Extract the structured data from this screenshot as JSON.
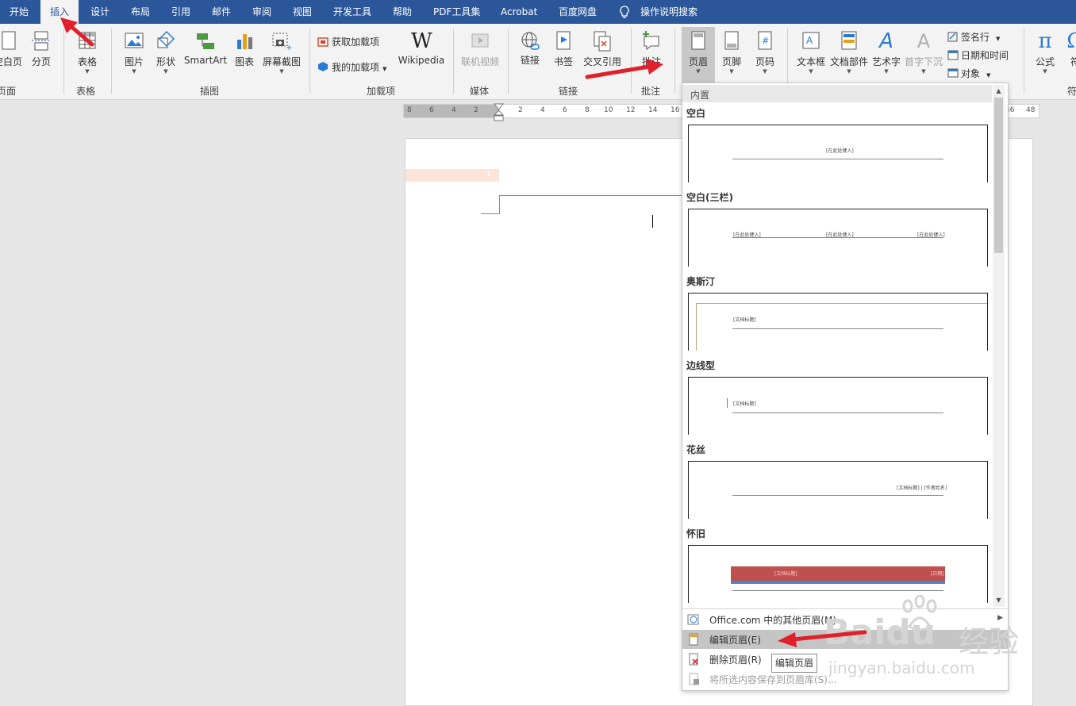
{
  "tabs": [
    {
      "label": "开始"
    },
    {
      "label": "插入"
    },
    {
      "label": "设计"
    },
    {
      "label": "布局"
    },
    {
      "label": "引用"
    },
    {
      "label": "邮件"
    },
    {
      "label": "审阅"
    },
    {
      "label": "视图"
    },
    {
      "label": "开发工具"
    },
    {
      "label": "帮助"
    },
    {
      "label": "PDF工具集"
    },
    {
      "label": "Acrobat"
    },
    {
      "label": "百度网盘"
    }
  ],
  "tell_me": "操作说明搜索",
  "ribbon": {
    "pages": {
      "blank_page": "空白页",
      "page_break": "分页",
      "label": "页面"
    },
    "tables": {
      "table": "表格",
      "label": "表格"
    },
    "illustrations": {
      "picture": "图片",
      "shapes": "形状",
      "smartart": "SmartArt",
      "chart": "图表",
      "screenshot": "屏幕截图",
      "label": "插图"
    },
    "addins": {
      "get": "获取加载项",
      "my": "我的加载项",
      "wikipedia": "Wikipedia",
      "label": "加载项"
    },
    "media": {
      "online_video": "联机视频",
      "label": "媒体"
    },
    "links": {
      "link": "链接",
      "bookmark": "书签",
      "cross_ref": "交叉引用",
      "label": "链接"
    },
    "comments": {
      "comment": "批注",
      "label": "批注"
    },
    "header_footer": {
      "header": "页眉",
      "footer": "页脚",
      "page_number": "页码"
    },
    "text": {
      "textbox": "文本框",
      "quick_parts": "文档部件",
      "wordart": "艺术字",
      "dropcap": "首字下沉",
      "signature": "签名行",
      "datetime": "日期和时间",
      "object": "对象"
    },
    "symbols": {
      "equation": "公式",
      "symbol": "符",
      "label": "符"
    }
  },
  "ruler": [
    "8",
    "6",
    "4",
    "2",
    "2",
    "4",
    "6",
    "8",
    "10",
    "12",
    "14",
    "16",
    "46",
    "48"
  ],
  "document": {
    "header_tag": "1"
  },
  "dropdown": {
    "section": "内置",
    "templates": [
      {
        "name": "空白",
        "fields": [
          "[在此处键入]"
        ]
      },
      {
        "name": "空白(三栏)",
        "fields": [
          "[在此处键入]",
          "[在此处键入]",
          "[在此处键入]"
        ]
      },
      {
        "name": "奥斯汀",
        "fields": [
          "[文档标题]"
        ]
      },
      {
        "name": "边线型",
        "fields": [
          "[文档标题]"
        ]
      },
      {
        "name": "花丝",
        "fields": [
          "[文档标题] | [作者姓名]"
        ]
      },
      {
        "name": "怀旧",
        "fields": [
          "[文档标题]",
          "[日期]"
        ]
      }
    ],
    "menu": {
      "more": "Office.com 中的其他页眉(M)",
      "edit": "编辑页眉(E)",
      "remove": "删除页眉(R)",
      "save": "将所选内容保存到页眉库(S)..."
    }
  },
  "tooltip": "编辑页眉",
  "watermark": {
    "brand": "Baidu",
    "cn": "经验",
    "url": "jingyan.baidu.com"
  },
  "colors": {
    "accent": "#2b579a",
    "arrow": "#e0202a",
    "vintage_red": "#c0504d",
    "vintage_blue": "#4f81bd"
  }
}
